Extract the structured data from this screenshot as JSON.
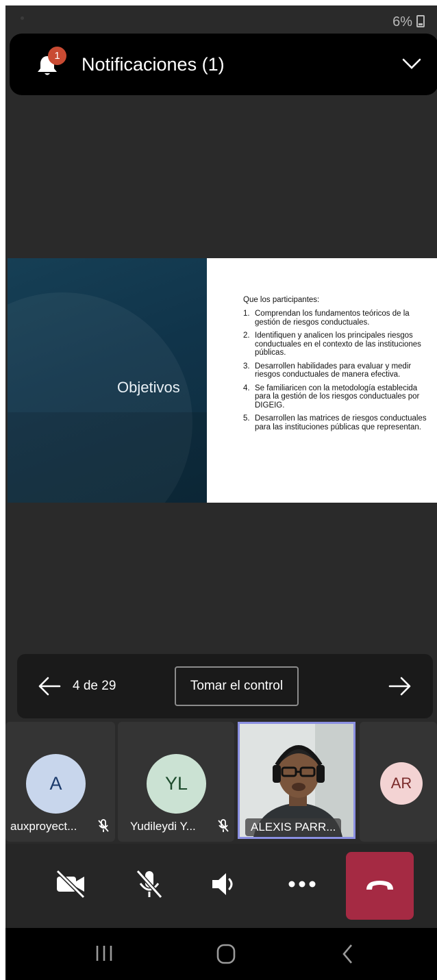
{
  "status_bar": {
    "battery": "6%",
    "icon": "battery-charging-icon"
  },
  "notification": {
    "badge": "1",
    "title": "Notificaciones (1)",
    "icons": [
      "bell-icon",
      "chevron-down-icon"
    ]
  },
  "slide": {
    "title": "Objetivos",
    "intro": "Que los participantes:",
    "items": [
      {
        "num": "1.",
        "text": "Comprendan los fundamentos teóricos de la gestión de riesgos conductuales."
      },
      {
        "num": "2.",
        "text": "Identifiquen y analicen los principales riesgos conductuales en el contexto de las instituciones públicas."
      },
      {
        "num": "3.",
        "text": "Desarrollen habilidades para evaluar y medir riesgos conductuales de manera efectiva."
      },
      {
        "num": "4.",
        "text": "Se familiaricen con la metodología establecida para la gestión de los riesgos conductuales por DIGEIG."
      },
      {
        "num": "5.",
        "text": "Desarrollen las matrices de riesgos conductuales para las instituciones públicas que representan."
      }
    ]
  },
  "presentation_controls": {
    "page": "4 de 29",
    "take_control": "Tomar el control"
  },
  "participants": [
    {
      "initials": "A",
      "name": "auxproyect...",
      "muted": true,
      "color": "#c8d6ec"
    },
    {
      "initials": "YL",
      "name": "Yudileydi Y...",
      "muted": true,
      "color": "#cbe2d3"
    },
    {
      "initials": "",
      "name": "ALEXIS PARR...",
      "muted": false,
      "video": true
    },
    {
      "initials": "AR",
      "name": "",
      "muted": false,
      "color": "#f3d3d3"
    }
  ],
  "call_controls": [
    "video-off-icon",
    "mic-off-icon",
    "speaker-icon",
    "more-icon",
    "hang-up-icon"
  ],
  "nav_bar": [
    "recent-apps-icon",
    "home-icon",
    "back-icon"
  ]
}
